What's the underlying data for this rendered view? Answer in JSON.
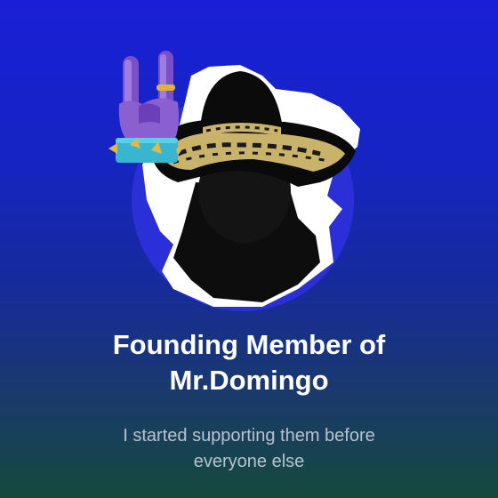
{
  "badge": {
    "title_line1": "Founding Member of",
    "title_line2": "Mr.Domingo",
    "subtitle_line1": "I started supporting them before",
    "subtitle_line2": "everyone else"
  },
  "icons": {
    "rock_hand": "rock-on-hand-icon",
    "avatar": "sombrero-silhouette-avatar"
  },
  "colors": {
    "background_top": "#1a1fd6",
    "background_bottom": "#144a3c",
    "avatar_circle": "#2b2fd8",
    "title_text": "#ffffff",
    "subtitle_text": "#b8c2d0",
    "hat_trim": "#c9b26a",
    "hand_fur": "#8a5fd0",
    "cuff": "#38b6d0"
  }
}
